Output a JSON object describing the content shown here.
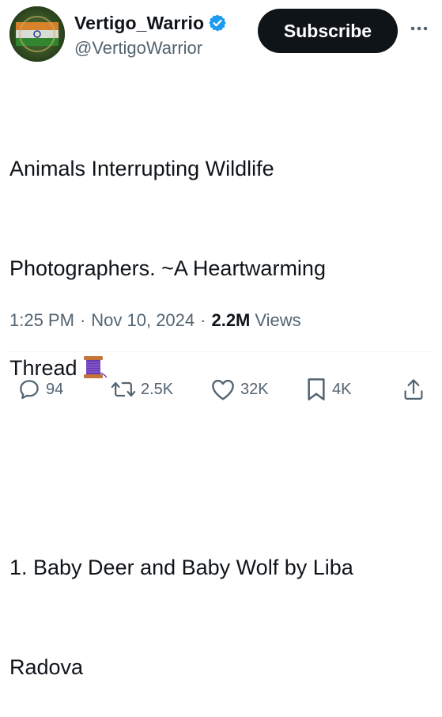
{
  "author": {
    "display_name": "Vertigo_Warrio",
    "handle": "@VertigoWarrior",
    "verified": true,
    "verified_color": "#1d9bf0"
  },
  "subscribe_button": {
    "label": "Subscribe"
  },
  "more_menu": {
    "icon": "more-horizontal-icon"
  },
  "tweet": {
    "lines": [
      "Animals Interrupting Wildlife",
      "Photographers. ~A Heartwarming",
      "Thread",
      "",
      "1. Baby Deer and Baby Wolf by Liba",
      "Radova"
    ],
    "emoji": "spool-of-thread-icon"
  },
  "meta": {
    "time": "1:25 PM",
    "separator": "·",
    "date": "Nov 10, 2024",
    "views_count": "2.2M",
    "views_label": "Views"
  },
  "actions": {
    "replies": "94",
    "reposts": "2.5K",
    "likes": "32K",
    "bookmarks": "4K"
  },
  "colors": {
    "text_primary": "#0f1419",
    "text_secondary": "#536471",
    "button_bg": "#0f1419",
    "divider": "#eff3f4"
  }
}
